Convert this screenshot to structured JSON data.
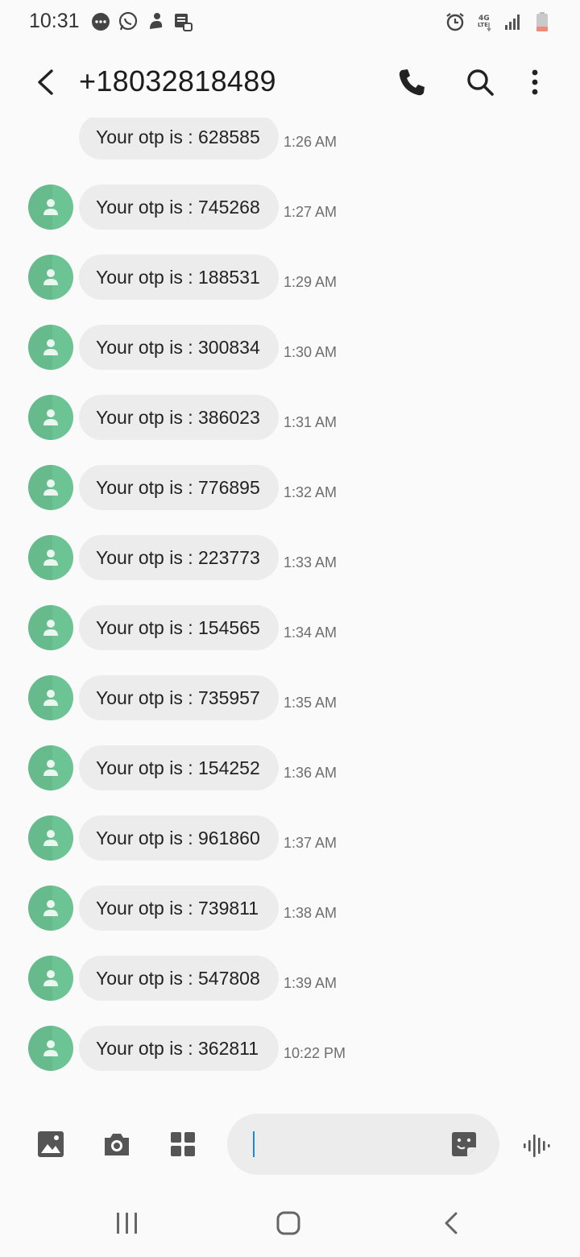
{
  "status_bar": {
    "time": "10:31",
    "left_icons": [
      "chat-icon",
      "whatsapp-icon",
      "sticker-app-icon",
      "sim-manager-icon"
    ],
    "right_icons": [
      "alarm-icon",
      "4g-lte-icon",
      "signal-icon",
      "battery-icon"
    ]
  },
  "header": {
    "title": "+18032818489",
    "back_icon": "back-arrow-icon",
    "actions": [
      "call-icon",
      "search-icon",
      "more-options-icon"
    ]
  },
  "messages": [
    {
      "text": "Your otp is : 628585",
      "time": "1:26 AM",
      "avatar": false
    },
    {
      "text": "Your otp is : 745268",
      "time": "1:27 AM",
      "avatar": true
    },
    {
      "text": "Your otp is : 188531",
      "time": "1:29 AM",
      "avatar": true
    },
    {
      "text": "Your otp is : 300834",
      "time": "1:30 AM",
      "avatar": true
    },
    {
      "text": "Your otp is : 386023",
      "time": "1:31 AM",
      "avatar": true
    },
    {
      "text": "Your otp is : 776895",
      "time": "1:32 AM",
      "avatar": true
    },
    {
      "text": "Your otp is : 223773",
      "time": "1:33 AM",
      "avatar": true
    },
    {
      "text": "Your otp is : 154565",
      "time": "1:34 AM",
      "avatar": true
    },
    {
      "text": "Your otp is : 735957",
      "time": "1:35 AM",
      "avatar": true
    },
    {
      "text": "Your otp is : 154252",
      "time": "1:36 AM",
      "avatar": true
    },
    {
      "text": "Your otp is : 961860",
      "time": "1:37 AM",
      "avatar": true
    },
    {
      "text": "Your otp is : 739811",
      "time": "1:38 AM",
      "avatar": true
    },
    {
      "text": "Your otp is : 547808",
      "time": "1:39 AM",
      "avatar": true
    },
    {
      "text": "Your otp is : 362811",
      "time": "10:22 PM",
      "avatar": true
    }
  ],
  "composer": {
    "placeholder": "",
    "value": "",
    "icons": [
      "gallery-icon",
      "camera-icon",
      "apps-icon",
      "sticker-icon",
      "voice-input-icon"
    ]
  },
  "nav_bar": {
    "icons": [
      "recents-icon",
      "home-icon",
      "back-icon"
    ]
  },
  "colors": {
    "background": "#fafafa",
    "bubble": "#ececec",
    "avatar": "#6cc494",
    "cursor": "#1a88c9",
    "time_text": "#6e6e6e"
  }
}
